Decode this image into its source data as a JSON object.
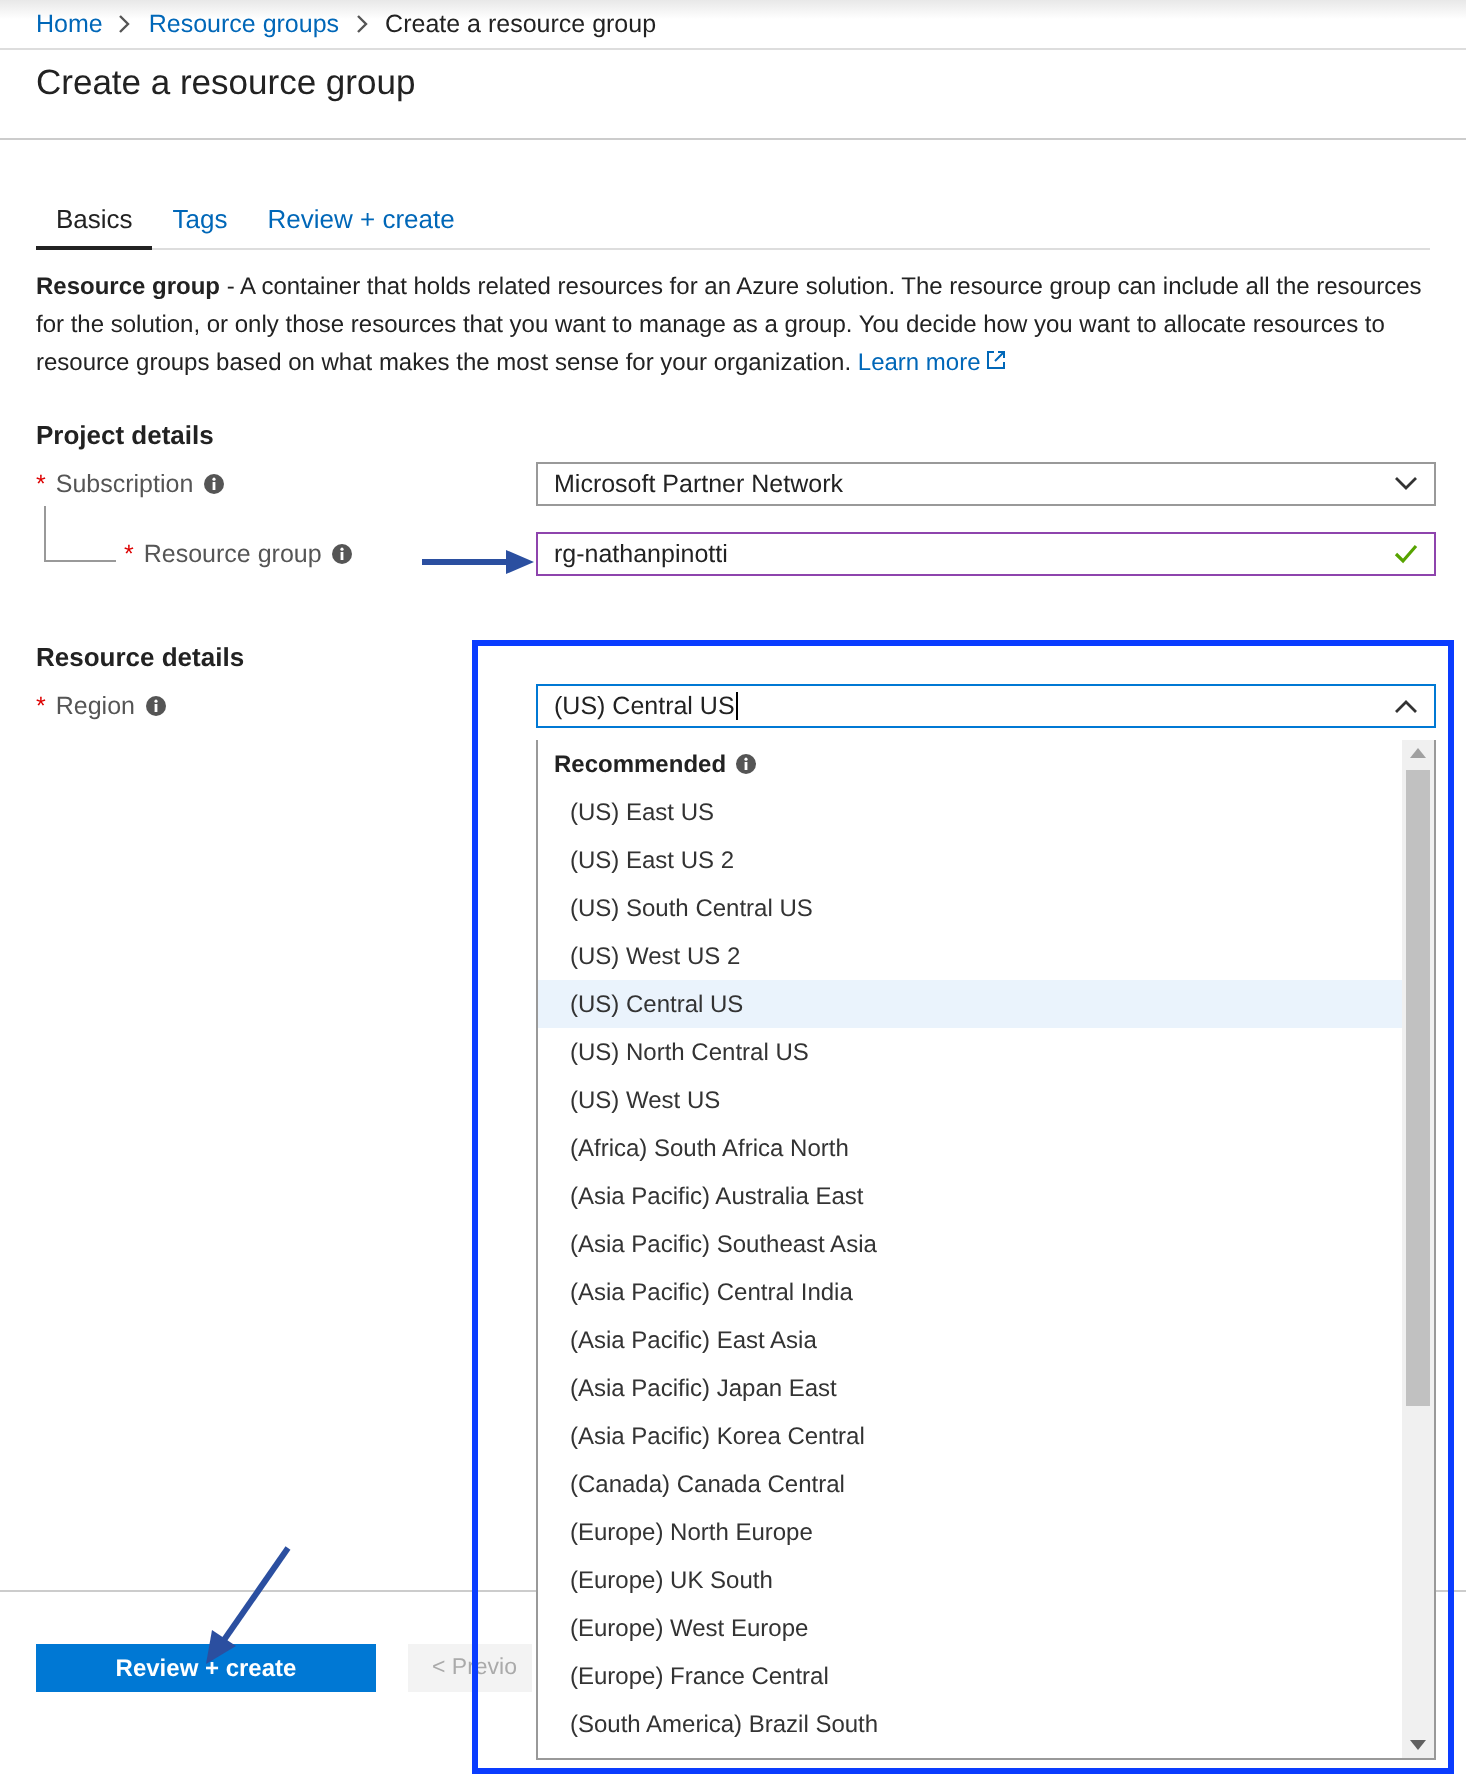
{
  "breadcrumbs": [
    {
      "label": "Home",
      "link": true
    },
    {
      "label": "Resource groups",
      "link": true
    },
    {
      "label": "Create a resource group",
      "link": false
    }
  ],
  "title": "Create a resource group",
  "tabs": [
    {
      "label": "Basics",
      "selected": true
    },
    {
      "label": "Tags",
      "selected": false
    },
    {
      "label": "Review + create",
      "selected": false
    }
  ],
  "description": {
    "text": "**Resource group** - A container that holds related resources for an Azure solution. The resource group can include all the resources for the solution, or only those resources that you want to manage as a group. You decide how you want to allocate resources to resource groups based on what makes the most sense for your organization.",
    "link": "Learn more"
  },
  "project_details": {
    "heading": "Project details",
    "subscription": {
      "required_mark": "*",
      "label": "Subscription",
      "value": "Microsoft Partner Network"
    },
    "resource_group": {
      "required_mark": "*",
      "label": "Resource group",
      "value": "rg-nathanpinotti",
      "valid": true
    }
  },
  "resource_details": {
    "heading": "Resource details",
    "region": {
      "required_mark": "*",
      "label": "Region",
      "value": "(US) Central US",
      "expanded": true,
      "group_label": "Recommended",
      "options": [
        {
          "label": "(US) East US",
          "selected": false
        },
        {
          "label": "(US) East US 2",
          "selected": false
        },
        {
          "label": "(US) South Central US",
          "selected": false
        },
        {
          "label": "(US) West US 2",
          "selected": false
        },
        {
          "label": "(US) Central US",
          "selected": true
        },
        {
          "label": "(US) North Central US",
          "selected": false
        },
        {
          "label": "(US) West US",
          "selected": false
        },
        {
          "label": "(Africa) South Africa North",
          "selected": false
        },
        {
          "label": "(Asia Pacific) Australia East",
          "selected": false
        },
        {
          "label": "(Asia Pacific) Southeast Asia",
          "selected": false
        },
        {
          "label": "(Asia Pacific) Central India",
          "selected": false
        },
        {
          "label": "(Asia Pacific) East Asia",
          "selected": false
        },
        {
          "label": "(Asia Pacific) Japan East",
          "selected": false
        },
        {
          "label": "(Asia Pacific) Korea Central",
          "selected": false
        },
        {
          "label": "(Canada) Canada Central",
          "selected": false
        },
        {
          "label": "(Europe) North Europe",
          "selected": false
        },
        {
          "label": "(Europe) UK South",
          "selected": false
        },
        {
          "label": "(Europe) West Europe",
          "selected": false
        },
        {
          "label": "(Europe) France Central",
          "selected": false
        },
        {
          "label": "(South America) Brazil South",
          "selected": false
        }
      ]
    }
  },
  "footer": {
    "primary": "Review + create",
    "previous": "< Previo"
  }
}
